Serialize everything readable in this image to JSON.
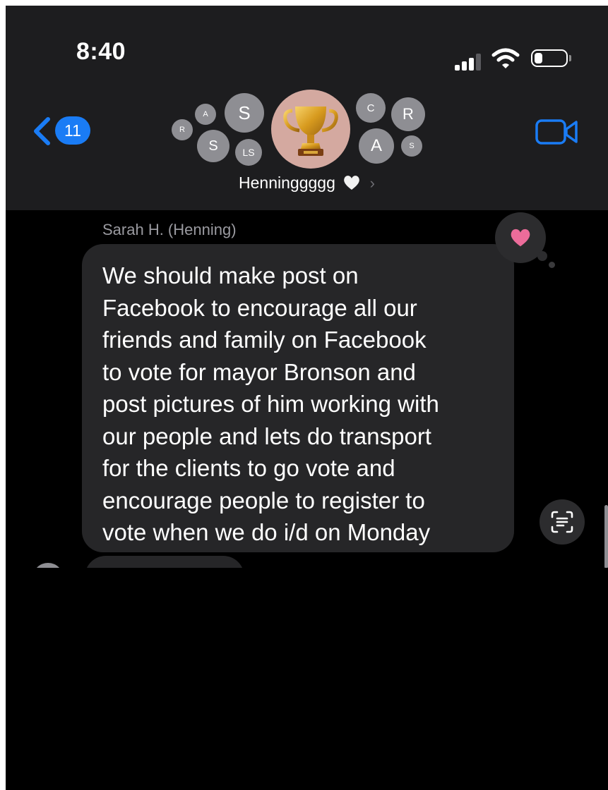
{
  "status_bar": {
    "time": "8:40",
    "signal_icon": "cellular-signal-icon",
    "wifi_icon": "wifi-icon",
    "battery_icon": "battery-icon",
    "battery_level": 0.25
  },
  "nav": {
    "back_icon": "chevron-left-icon",
    "back_badge": "11",
    "video_icon": "video-camera-icon",
    "group_name": "Henninggggg",
    "group_name_heart_icon": "white-heart-icon",
    "group_chevron_icon": "chevron-right-icon",
    "group_photo_icon": "trophy-icon",
    "avatars": {
      "r_left": "R",
      "a_left": "A",
      "s_big": "S",
      "s_lower": "S",
      "ls": "LS",
      "c": "C",
      "r_right": "R",
      "a_right": "A",
      "s_small": "S"
    }
  },
  "message": {
    "sender": "Sarah H. (Henning)",
    "text": "We should make post on\nFacebook to encourage all our\nfriends and family  on Facebook\nto vote for mayor Bronson  and\npost pictures of him working with\nour people and lets do transport\nfor the clients to go vote  and\nencourage people to register to\nvote when we do i/d on Monday",
    "tapback_icon": "pink-heart-icon",
    "live_text_icon": "live-text-icon"
  },
  "colors": {
    "accent": "#1a7cf5",
    "bubble": "#262628",
    "header": "#1d1d1f",
    "tapback_heart": "#ec6c9a"
  }
}
